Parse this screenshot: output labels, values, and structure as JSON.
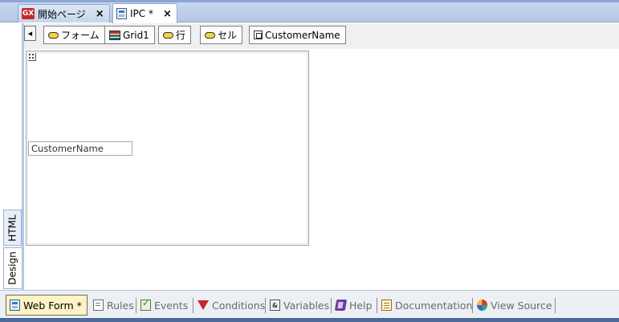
{
  "document_tabs": [
    {
      "label": "開始ページ",
      "icon": "genexus-icon",
      "close": "×",
      "active": false
    },
    {
      "label": "IPC *",
      "icon": "web-form-icon",
      "close": "×",
      "active": true
    }
  ],
  "vertical_tabs": [
    {
      "label": "HTML",
      "active": false
    },
    {
      "label": "Design",
      "active": true
    }
  ],
  "designer_toolbar": {
    "scroll_left": "◀",
    "crumbs": [
      {
        "label": "フォーム",
        "icon": "form-pill-icon"
      },
      {
        "label": "Grid1",
        "icon": "grid-icon"
      },
      {
        "label": "行",
        "icon": "row-pill-icon"
      },
      {
        "label": "セル",
        "icon": "cell-pill-icon"
      },
      {
        "label": "CustomerName",
        "icon": "attribute-icon"
      }
    ]
  },
  "canvas": {
    "field_value": "CustomerName"
  },
  "section_tabs": [
    {
      "label": "Web Form *",
      "icon": "web-form-icon",
      "active": true
    },
    {
      "label": "Rules",
      "icon": "rules-icon"
    },
    {
      "label": "Events",
      "icon": "events-icon"
    },
    {
      "label": "Conditions",
      "icon": "conditions-funnel-icon"
    },
    {
      "label": "Variables",
      "icon": "variables-icon"
    },
    {
      "label": "Help",
      "icon": "help-book-icon"
    },
    {
      "label": "Documentation",
      "icon": "documentation-icon"
    },
    {
      "label": "View Source",
      "icon": "view-source-icon"
    }
  ],
  "colors": {
    "tab_strip": "#b4c8e6",
    "active_section_tab": "#fdf3c4",
    "accent_bar": "#4b6a9a"
  }
}
